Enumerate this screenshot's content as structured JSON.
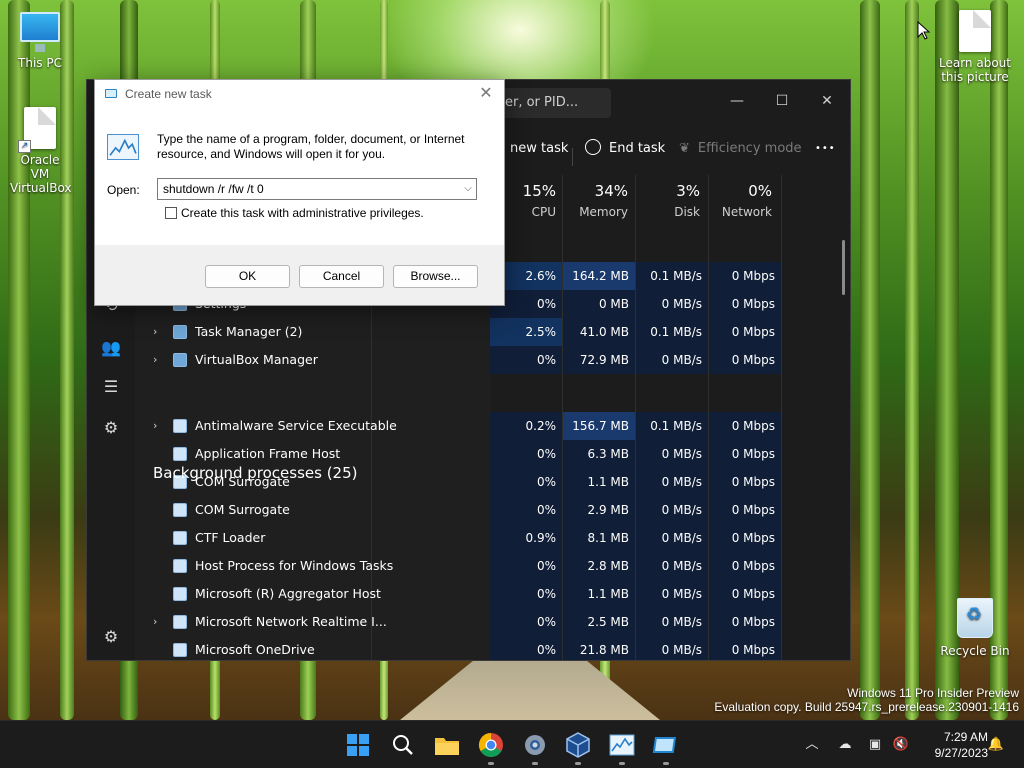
{
  "desktop": {
    "icons": [
      {
        "label": "This PC",
        "icon": "monitor-icon"
      },
      {
        "label": "Oracle VM VirtualBox",
        "icon": "shortcut-file-icon"
      },
      {
        "label": "Learn about this picture",
        "icon": "file-icon"
      },
      {
        "label": "Recycle Bin",
        "icon": "recycle-bin-icon"
      }
    ],
    "watermark": {
      "line1": "Windows 11 Pro Insider Preview",
      "line2": "Evaluation copy. Build 25947.rs_prerelease.230901-1416"
    }
  },
  "task_manager": {
    "search_placeholder": "er, or PID...",
    "window_buttons": {
      "minimize": "—",
      "maximize": "☐",
      "close": "✕"
    },
    "toolbar": {
      "run_new_task": "new task",
      "end_task": "End task",
      "efficiency_mode": "Efficiency mode",
      "more": "•••"
    },
    "columns": [
      {
        "percent": "15%",
        "label": "CPU"
      },
      {
        "percent": "34%",
        "label": "Memory"
      },
      {
        "percent": "3%",
        "label": "Disk"
      },
      {
        "percent": "0%",
        "label": "Network"
      }
    ],
    "apps_rows": [
      {
        "name": "",
        "cpu": "2.6%",
        "memory": "164.2 MB",
        "disk": "0.1 MB/s",
        "network": "0 Mbps"
      },
      {
        "name": "Settings",
        "cpu": "0%",
        "memory": "0 MB",
        "disk": "0 MB/s",
        "network": "0 Mbps"
      },
      {
        "name": "Task Manager (2)",
        "cpu": "2.5%",
        "memory": "41.0 MB",
        "disk": "0.1 MB/s",
        "network": "0 Mbps"
      },
      {
        "name": "VirtualBox Manager",
        "cpu": "0%",
        "memory": "72.9 MB",
        "disk": "0 MB/s",
        "network": "0 Mbps"
      }
    ],
    "background_header": "Background processes (25)",
    "background_rows": [
      {
        "name": "Antimalware Service Executable",
        "cpu": "0.2%",
        "memory": "156.7 MB",
        "disk": "0.1 MB/s",
        "network": "0 Mbps"
      },
      {
        "name": "Application Frame Host",
        "cpu": "0%",
        "memory": "6.3 MB",
        "disk": "0 MB/s",
        "network": "0 Mbps"
      },
      {
        "name": "COM Surrogate",
        "cpu": "0%",
        "memory": "1.1 MB",
        "disk": "0 MB/s",
        "network": "0 Mbps"
      },
      {
        "name": "COM Surrogate",
        "cpu": "0%",
        "memory": "2.9 MB",
        "disk": "0 MB/s",
        "network": "0 Mbps"
      },
      {
        "name": "CTF Loader",
        "cpu": "0.9%",
        "memory": "8.1 MB",
        "disk": "0 MB/s",
        "network": "0 Mbps"
      },
      {
        "name": "Host Process for Windows Tasks",
        "cpu": "0%",
        "memory": "2.8 MB",
        "disk": "0 MB/s",
        "network": "0 Mbps"
      },
      {
        "name": "Microsoft (R) Aggregator Host",
        "cpu": "0%",
        "memory": "1.1 MB",
        "disk": "0 MB/s",
        "network": "0 Mbps"
      },
      {
        "name": "Microsoft Network Realtime I...",
        "cpu": "0%",
        "memory": "2.5 MB",
        "disk": "0 MB/s",
        "network": "0 Mbps"
      },
      {
        "name": "Microsoft OneDrive",
        "cpu": "0%",
        "memory": "21.8 MB",
        "disk": "0 MB/s",
        "network": "0 Mbps"
      }
    ]
  },
  "dialog": {
    "title": "Create new task",
    "close": "✕",
    "description": "Type the name of a program, folder, document, or Internet resource, and Windows will open it for you.",
    "open_label": "Open:",
    "open_value": "shutdown /r /fw /t 0",
    "checkbox_label": "Create this task with administrative privileges.",
    "checkbox_checked": false,
    "buttons": {
      "ok": "OK",
      "cancel": "Cancel",
      "browse": "Browse..."
    }
  },
  "taskbar": {
    "apps": [
      "start-icon",
      "search-icon",
      "file-explorer-icon",
      "chrome-icon",
      "settings-icon",
      "virtualbox-icon",
      "task-manager-icon",
      "remote-desktop-icon"
    ],
    "clock_time": "7:29 AM",
    "clock_date": "9/27/2023",
    "tray": [
      "chevron-up-icon",
      "onedrive-icon",
      "network-icon",
      "volume-muted-icon",
      "notification-bell-icon"
    ]
  },
  "colors": {
    "accent": "#0b57d0",
    "highlight_dark": "#1a3a6e",
    "highlight_light": "#12284d",
    "taskbar": "#1c1c1c"
  }
}
